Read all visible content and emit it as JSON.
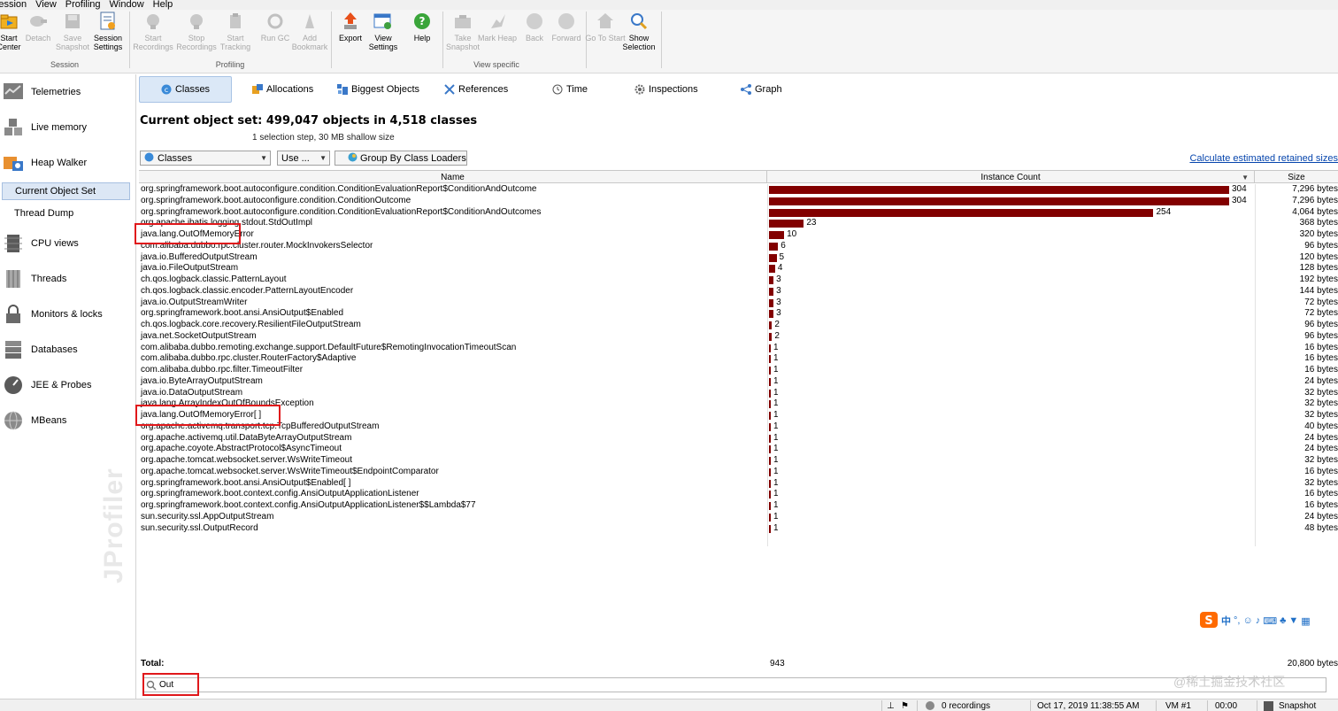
{
  "menu": [
    "Session",
    "View",
    "Profiling",
    "Window",
    "Help"
  ],
  "toolbar": {
    "session_group": "Session",
    "profiling_group": "Profiling",
    "view_group": "View specific",
    "buttons": [
      {
        "label": "Start Center",
        "enabled": true
      },
      {
        "label": "Detach",
        "enabled": false
      },
      {
        "label": "Save Snapshot",
        "enabled": false
      },
      {
        "label": "Session Settings",
        "enabled": true
      },
      {
        "label": "Start Recordings",
        "enabled": false
      },
      {
        "label": "Stop Recordings",
        "enabled": false
      },
      {
        "label": "Start Tracking",
        "enabled": false
      },
      {
        "label": "Run GC",
        "enabled": false
      },
      {
        "label": "Add Bookmark",
        "enabled": false
      },
      {
        "label": "Export",
        "enabled": true
      },
      {
        "label": "View Settings",
        "enabled": true
      },
      {
        "label": "Help",
        "enabled": true
      },
      {
        "label": "Take Snapshot",
        "enabled": false
      },
      {
        "label": "Mark Heap",
        "enabled": false
      },
      {
        "label": "Back",
        "enabled": false
      },
      {
        "label": "Forward",
        "enabled": false
      },
      {
        "label": "Go To Start",
        "enabled": false
      },
      {
        "label": "Show Selection",
        "enabled": true
      }
    ]
  },
  "sidebar": {
    "items": [
      {
        "label": "Telemetries",
        "icon": "telemetries-icon"
      },
      {
        "label": "Live memory",
        "icon": "live-memory-icon"
      },
      {
        "label": "Heap Walker",
        "icon": "heap-walker-icon"
      },
      {
        "label": "CPU views",
        "icon": "cpu-views-icon"
      },
      {
        "label": "Threads",
        "icon": "threads-icon"
      },
      {
        "label": "Monitors & locks",
        "icon": "monitors-locks-icon"
      },
      {
        "label": "Databases",
        "icon": "databases-icon"
      },
      {
        "label": "JEE & Probes",
        "icon": "jee-probes-icon"
      },
      {
        "label": "MBeans",
        "icon": "mbeans-icon"
      }
    ],
    "sub_items": [
      "Current Object Set",
      "Thread Dump"
    ],
    "watermark": "JProfiler"
  },
  "tabs": [
    "Classes",
    "Allocations",
    "Biggest Objects",
    "References",
    "Time",
    "Inspections",
    "Graph"
  ],
  "object_set": {
    "title": "Current object set:  499,047 objects in 4,518 classes",
    "subtitle": "1 selection step, 30 MB shallow size"
  },
  "controls": {
    "view_combo": "Classes",
    "use_button": "Use ...",
    "group_button": "Group By Class Loaders",
    "retained_link": "Calculate estimated retained sizes"
  },
  "table": {
    "columns": [
      "Name",
      "Instance Count",
      "Size"
    ],
    "max_count": 304,
    "rows": [
      {
        "name": "org.springframework.boot.autoconfigure.condition.ConditionEvaluationReport$ConditionAndOutcome",
        "count": 304,
        "size": "7,296 bytes"
      },
      {
        "name": "org.springframework.boot.autoconfigure.condition.ConditionOutcome",
        "count": 304,
        "size": "7,296 bytes"
      },
      {
        "name": "org.springframework.boot.autoconfigure.condition.ConditionEvaluationReport$ConditionAndOutcomes",
        "count": 254,
        "size": "4,064 bytes"
      },
      {
        "name": "org.apache.ibatis.logging.stdout.StdOutImpl",
        "count": 23,
        "size": "368 bytes"
      },
      {
        "name": "java.lang.OutOfMemoryError",
        "count": 10,
        "size": "320 bytes"
      },
      {
        "name": "com.alibaba.dubbo.rpc.cluster.router.MockInvokersSelector",
        "count": 6,
        "size": "96 bytes"
      },
      {
        "name": "java.io.BufferedOutputStream",
        "count": 5,
        "size": "120 bytes"
      },
      {
        "name": "java.io.FileOutputStream",
        "count": 4,
        "size": "128 bytes"
      },
      {
        "name": "ch.qos.logback.classic.PatternLayout",
        "count": 3,
        "size": "192 bytes"
      },
      {
        "name": "ch.qos.logback.classic.encoder.PatternLayoutEncoder",
        "count": 3,
        "size": "144 bytes"
      },
      {
        "name": "java.io.OutputStreamWriter",
        "count": 3,
        "size": "72 bytes"
      },
      {
        "name": "org.springframework.boot.ansi.AnsiOutput$Enabled",
        "count": 3,
        "size": "72 bytes"
      },
      {
        "name": "ch.qos.logback.core.recovery.ResilientFileOutputStream",
        "count": 2,
        "size": "96 bytes"
      },
      {
        "name": "java.net.SocketOutputStream",
        "count": 2,
        "size": "96 bytes"
      },
      {
        "name": "com.alibaba.dubbo.remoting.exchange.support.DefaultFuture$RemotingInvocationTimeoutScan",
        "count": 1,
        "size": "16 bytes"
      },
      {
        "name": "com.alibaba.dubbo.rpc.cluster.RouterFactory$Adaptive",
        "count": 1,
        "size": "16 bytes"
      },
      {
        "name": "com.alibaba.dubbo.rpc.filter.TimeoutFilter",
        "count": 1,
        "size": "16 bytes"
      },
      {
        "name": "java.io.ByteArrayOutputStream",
        "count": 1,
        "size": "24 bytes"
      },
      {
        "name": "java.io.DataOutputStream",
        "count": 1,
        "size": "32 bytes"
      },
      {
        "name": "java.lang.ArrayIndexOutOfBoundsException",
        "count": 1,
        "size": "32 bytes"
      },
      {
        "name": "java.lang.OutOfMemoryError[ ]",
        "count": 1,
        "size": "32 bytes"
      },
      {
        "name": "org.apache.activemq.transport.tcp.TcpBufferedOutputStream",
        "count": 1,
        "size": "40 bytes"
      },
      {
        "name": "org.apache.activemq.util.DataByteArrayOutputStream",
        "count": 1,
        "size": "24 bytes"
      },
      {
        "name": "org.apache.coyote.AbstractProtocol$AsyncTimeout",
        "count": 1,
        "size": "24 bytes"
      },
      {
        "name": "org.apache.tomcat.websocket.server.WsWriteTimeout",
        "count": 1,
        "size": "32 bytes"
      },
      {
        "name": "org.apache.tomcat.websocket.server.WsWriteTimeout$EndpointComparator",
        "count": 1,
        "size": "16 bytes"
      },
      {
        "name": "org.springframework.boot.ansi.AnsiOutput$Enabled[ ]",
        "count": 1,
        "size": "32 bytes"
      },
      {
        "name": "org.springframework.boot.context.config.AnsiOutputApplicationListener",
        "count": 1,
        "size": "16 bytes"
      },
      {
        "name": "org.springframework.boot.context.config.AnsiOutputApplicationListener$$Lambda$77",
        "count": 1,
        "size": "16 bytes"
      },
      {
        "name": "sun.security.ssl.AppOutputStream",
        "count": 1,
        "size": "24 bytes"
      },
      {
        "name": "sun.security.ssl.OutputRecord",
        "count": 1,
        "size": "48 bytes"
      }
    ],
    "total_label": "Total:",
    "total_count": "943",
    "total_size": "20,800 bytes"
  },
  "search": {
    "value": "Out"
  },
  "status": {
    "recordings": "0 recordings",
    "datetime": "Oct 17, 2019 11:38:55 AM",
    "vm": "VM #1",
    "elapsed": "00:00",
    "mode": "Snapshot"
  },
  "overlay": {
    "ime_char": "中",
    "site_watermark": "@稀土掘金技术社区"
  },
  "colors": {
    "bar": "#820000",
    "highlight": "#e0181b",
    "link": "#0645ad",
    "selected_tab_bg": "#dbe8f7"
  }
}
